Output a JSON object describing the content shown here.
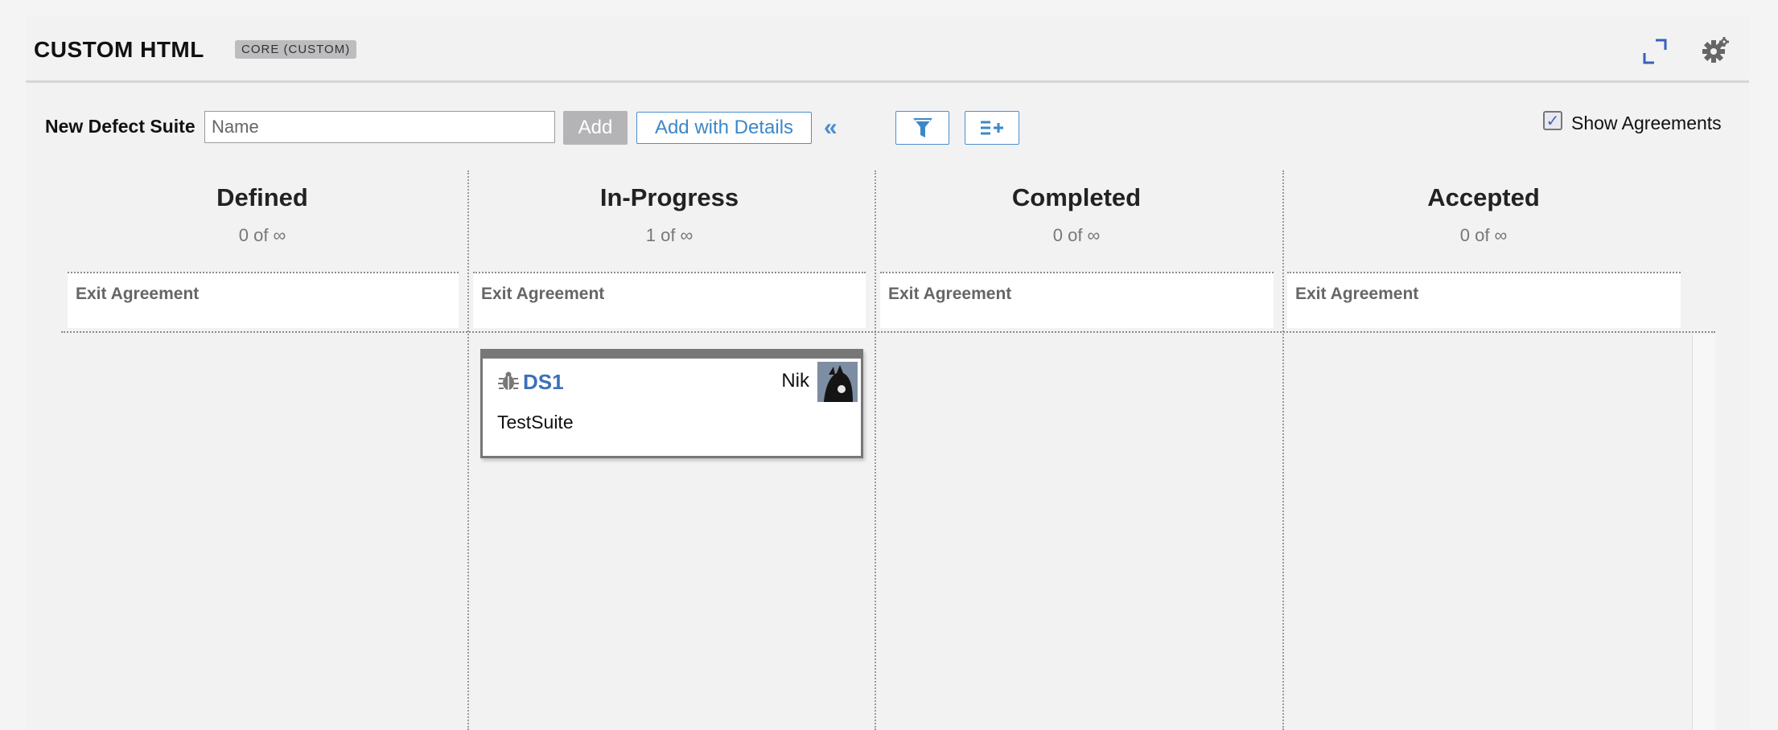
{
  "header": {
    "title": "CUSTOM HTML",
    "badge": "CORE (CUSTOM)",
    "expand_icon": "expand-icon",
    "settings_icon": "gear-icon"
  },
  "toolbar": {
    "label": "New Defect Suite",
    "name_placeholder": "Name",
    "name_value": "",
    "add_label": "Add",
    "add_details_label": "Add with Details",
    "collapse_icon": "double-chevron-left-icon",
    "filter_icon": "filter-icon",
    "fields_icon": "list-add-icon",
    "show_agreements_label": "Show Agreements",
    "show_agreements_checked": true
  },
  "columns": [
    {
      "title": "Defined",
      "count": "0 of ∞",
      "exit_label": "Exit Agreement"
    },
    {
      "title": "In-Progress",
      "count": "1 of ∞",
      "exit_label": "Exit Agreement"
    },
    {
      "title": "Completed",
      "count": "0 of ∞",
      "exit_label": "Exit Agreement"
    },
    {
      "title": "Accepted",
      "count": "0 of ∞",
      "exit_label": "Exit Agreement"
    }
  ],
  "cards": [
    {
      "column": "In-Progress",
      "id": "DS1",
      "owner": "Nik",
      "name": "TestSuite",
      "icon": "defect-suite-icon"
    }
  ],
  "colors": {
    "accent": "#4b8fce",
    "card_border": "#777777",
    "link": "#3d6fb8"
  }
}
